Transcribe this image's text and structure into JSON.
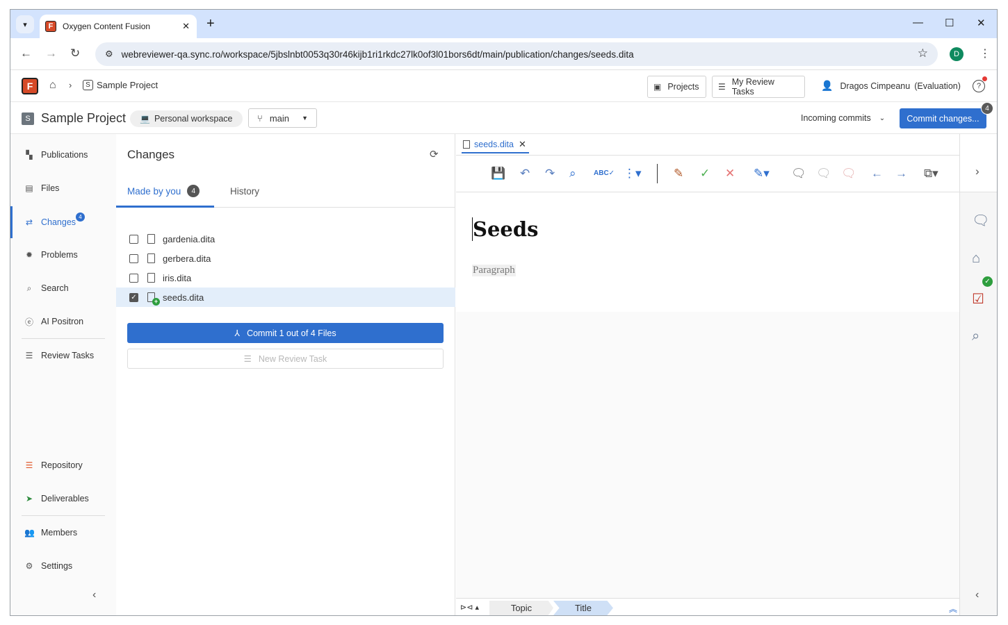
{
  "browser": {
    "tab_title": "Oxygen Content Fusion",
    "favicon_letter": "F",
    "url": "webreviewer-qa.sync.ro/workspace/5jbslnbt0053q30r46kijb1ri1rkdc27lk0of3l01bors6dt/main/publication/changes/seeds.dita",
    "profile_initial": "D"
  },
  "header": {
    "logo_letter": "F",
    "breadcrumb_project": "Sample Project",
    "project_initial": "S",
    "projects_label": "Projects",
    "review_tasks_label": "My Review Tasks",
    "user_name": "Dragos Cimpeanu",
    "user_status": "(Evaluation)"
  },
  "projectbar": {
    "project_initial": "S",
    "project_name": "Sample Project",
    "workspace_label": "Personal workspace",
    "branch": "main",
    "incoming_commits": "Incoming commits",
    "commit_label": "Commit changes...",
    "commit_badge": "4"
  },
  "sidebar": {
    "items": [
      {
        "label": "Publications",
        "icon": "publications-icon"
      },
      {
        "label": "Files",
        "icon": "file-icon"
      },
      {
        "label": "Changes",
        "icon": "changes-icon",
        "badge": "4"
      },
      {
        "label": "Problems",
        "icon": "bug-icon"
      },
      {
        "label": "Search",
        "icon": "search-icon"
      },
      {
        "label": "AI Positron",
        "icon": "ai-icon"
      },
      {
        "label": "Review Tasks",
        "icon": "list-icon"
      },
      {
        "label": "Repository",
        "icon": "repository-icon"
      },
      {
        "label": "Deliverables",
        "icon": "send-icon"
      },
      {
        "label": "Members",
        "icon": "members-icon"
      },
      {
        "label": "Settings",
        "icon": "gear-icon"
      }
    ]
  },
  "changes": {
    "title": "Changes",
    "tab_made_by_you": "Made by you",
    "tab_count": "4",
    "tab_history": "History",
    "files": [
      {
        "name": "gardenia.dita",
        "checked": false
      },
      {
        "name": "gerbera.dita",
        "checked": false
      },
      {
        "name": "iris.dita",
        "checked": false
      },
      {
        "name": "seeds.dita",
        "checked": true
      }
    ],
    "commit_button": "Commit 1 out of 4 Files",
    "new_review_button": "New Review Task"
  },
  "editor": {
    "tab_name": "seeds.dita",
    "doc_title": "Seeds",
    "doc_paragraph": "Paragraph",
    "breadcrumb": [
      "Topic",
      "Title"
    ]
  },
  "colors": {
    "accent": "#2f6fce",
    "brand": "#d64a28",
    "success": "#2e9e3e",
    "danger": "#e53935"
  }
}
